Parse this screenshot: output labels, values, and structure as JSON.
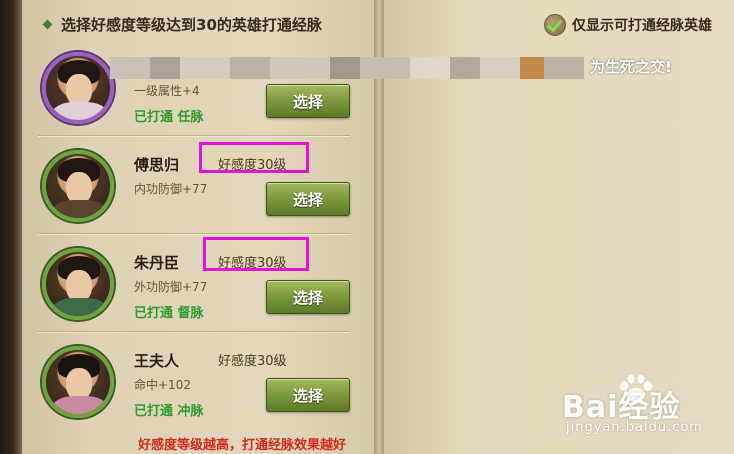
{
  "header": {
    "title": "选择好感度等级达到30的英雄打通经脉",
    "filter_label": "仅显示可打通经脉英雄"
  },
  "banner": {
    "visible_text": "为生死之交!"
  },
  "heroes": [
    {
      "name": "",
      "affinity": "",
      "stat": "一级属性+4",
      "meridian": "已打通  任脉",
      "button": "选择",
      "frame": "purple"
    },
    {
      "name": "傅思归",
      "affinity": "好感度30级",
      "stat": "内功防御+77",
      "meridian": "",
      "button": "选择",
      "frame": "green"
    },
    {
      "name": "朱丹臣",
      "affinity": "好感度30级",
      "stat": "外功防御+77",
      "meridian": "已打通  督脉",
      "button": "选择",
      "frame": "green"
    },
    {
      "name": "王夫人",
      "affinity": "好感度30级",
      "stat": "命中+102",
      "meridian": "已打通  冲脉",
      "button": "选择",
      "frame": "green"
    }
  ],
  "footer": {
    "tip": "好感度等级越高，打通经脉效果越好"
  },
  "watermark": {
    "brand": "Bai经验",
    "url": "jingyan.baidu.com"
  },
  "colors": {
    "accent_green": "#6fa53e",
    "highlight": "#e313d6",
    "tip_red": "#d42a1a",
    "meridian_green": "#2f9a2c"
  }
}
